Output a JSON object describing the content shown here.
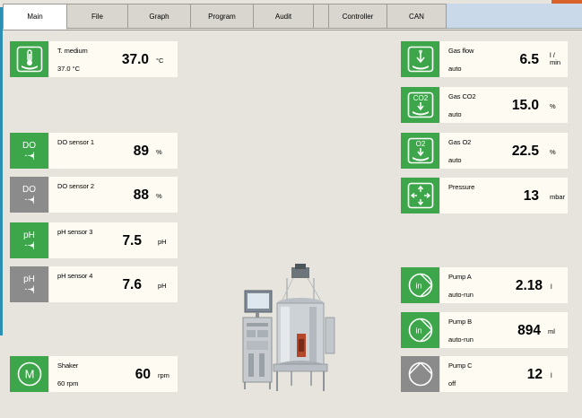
{
  "tabs": [
    {
      "label": "Main",
      "active": true
    },
    {
      "label": "File"
    },
    {
      "label": "Graph"
    },
    {
      "label": "Program"
    },
    {
      "label": "Audit"
    },
    {
      "label": ""
    },
    {
      "label": "Controller"
    },
    {
      "label": "CAN"
    }
  ],
  "left": {
    "temperature": {
      "label": "T. medium",
      "sub": "37.0 °C",
      "value": "37.0",
      "unit": "°C",
      "icon": "thermometer-icon"
    },
    "do1": {
      "label": "DO sensor 1",
      "value": "89",
      "unit": "%",
      "icon_text": "DO",
      "icon": "do-sensor-icon"
    },
    "do2": {
      "label": "DO sensor 2",
      "value": "88",
      "unit": "%",
      "icon_text": "DO",
      "icon": "do-sensor-icon"
    },
    "ph3": {
      "label": "pH sensor 3",
      "value": "7.5",
      "unit": "pH",
      "icon_text": "pH",
      "icon": "ph-sensor-icon"
    },
    "ph4": {
      "label": "pH sensor 4",
      "value": "7.6",
      "unit": "pH",
      "icon_text": "pH",
      "icon": "ph-sensor-icon"
    },
    "shaker": {
      "label": "Shaker",
      "sub": "60 rpm",
      "value": "60",
      "unit": "rpm",
      "icon_text": "M",
      "icon": "motor-icon"
    }
  },
  "right": {
    "gasflow": {
      "label": "Gas flow",
      "sub": "auto",
      "value": "6.5",
      "unit_top": "l /",
      "unit_bottom": "min",
      "icon": "gas-flow-icon"
    },
    "gasco2": {
      "label": "Gas CO2",
      "sub": "auto",
      "value": "15.0",
      "unit": "%",
      "icon_text": "CO2",
      "icon": "co2-icon"
    },
    "gaso2": {
      "label": "Gas O2",
      "sub": "auto",
      "value": "22.5",
      "unit": "%",
      "icon_text": "O2",
      "icon": "o2-icon"
    },
    "pressure": {
      "label": "Pressure",
      "value": "13",
      "unit": "mbar",
      "icon": "pressure-icon"
    },
    "pumpA": {
      "label": "Pump  A",
      "sub": "auto-run",
      "value": "2.18",
      "unit": "l",
      "icon_text": "in",
      "icon": "pump-in-icon"
    },
    "pumpB": {
      "label": "Pump  B",
      "sub": "auto-run",
      "value": "894",
      "unit": "ml",
      "icon_text": "in",
      "icon": "pump-in-icon"
    },
    "pumpC": {
      "label": "Pump  C",
      "sub": "off",
      "value": "12",
      "unit": "l",
      "icon": "pump-off-icon"
    }
  },
  "colors": {
    "green": "#3da64a",
    "gray": "#8b8b8b",
    "panel": "#fdfbf2",
    "accent_blue": "#2a8fb3",
    "accent_orange": "#d9622b"
  }
}
